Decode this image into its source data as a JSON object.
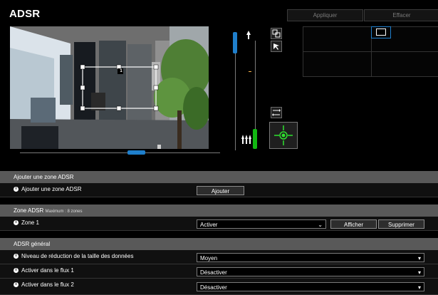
{
  "app": {
    "title": "ADSR",
    "apply_label": "Appliquer",
    "clear_label": "Effacer"
  },
  "camera_view": {
    "zone_label": "1",
    "zoom_slider_position": 0.18,
    "focus_slider_position": 0.93,
    "horizontal_slider_position": 0.55
  },
  "sections": {
    "add_zone": {
      "header": "Ajouter une zone ADSR",
      "row_label": "Ajouter une zone ADSR",
      "button_label": "Ajouter"
    },
    "zones": {
      "header": "Zone ADSR",
      "header_note": "Maximum : 8 zones",
      "row_label": "Zone 1",
      "selected": "Activer",
      "show_label": "Afficher",
      "delete_label": "Supprimer"
    },
    "general": {
      "header": "ADSR général",
      "rows": [
        {
          "label": "Niveau de réduction de la taille des données",
          "value": "Moyen"
        },
        {
          "label": "Activer dans le flux 1",
          "value": "Désactiver"
        },
        {
          "label": "Activer dans le flux 2",
          "value": "Désactiver"
        }
      ]
    }
  },
  "colors": {
    "accent_blue": "#1f7fcc",
    "accent_green": "#12b812",
    "orange": "#ffb84d",
    "header_gray": "#595959"
  }
}
